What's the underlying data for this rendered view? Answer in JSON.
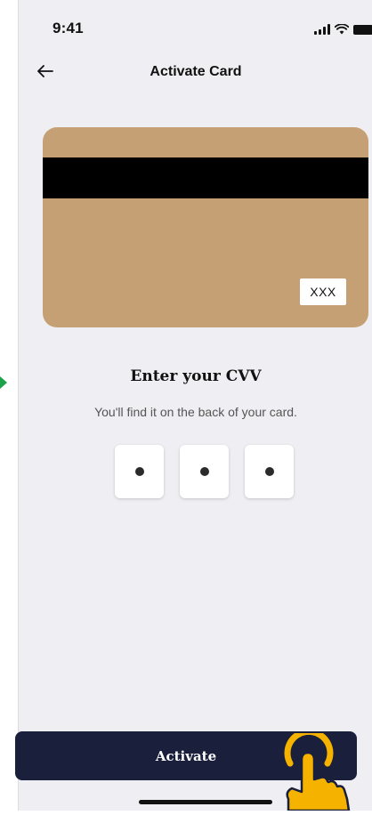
{
  "status_bar": {
    "time": "9:41"
  },
  "nav": {
    "title": "Activate Card"
  },
  "card": {
    "cvv_placeholder": "XXX",
    "color": "#c5a074"
  },
  "cvv": {
    "heading": "Enter your CVV",
    "subtext": "You'll find it on the back of your card.",
    "digits_entered": 3,
    "digits_total": 3
  },
  "actions": {
    "activate_label": "Activate"
  },
  "colors": {
    "button": "#1a1f3c",
    "background": "#efeff3",
    "tap_hint": "#f5b300",
    "marker": "#1aa34a"
  }
}
